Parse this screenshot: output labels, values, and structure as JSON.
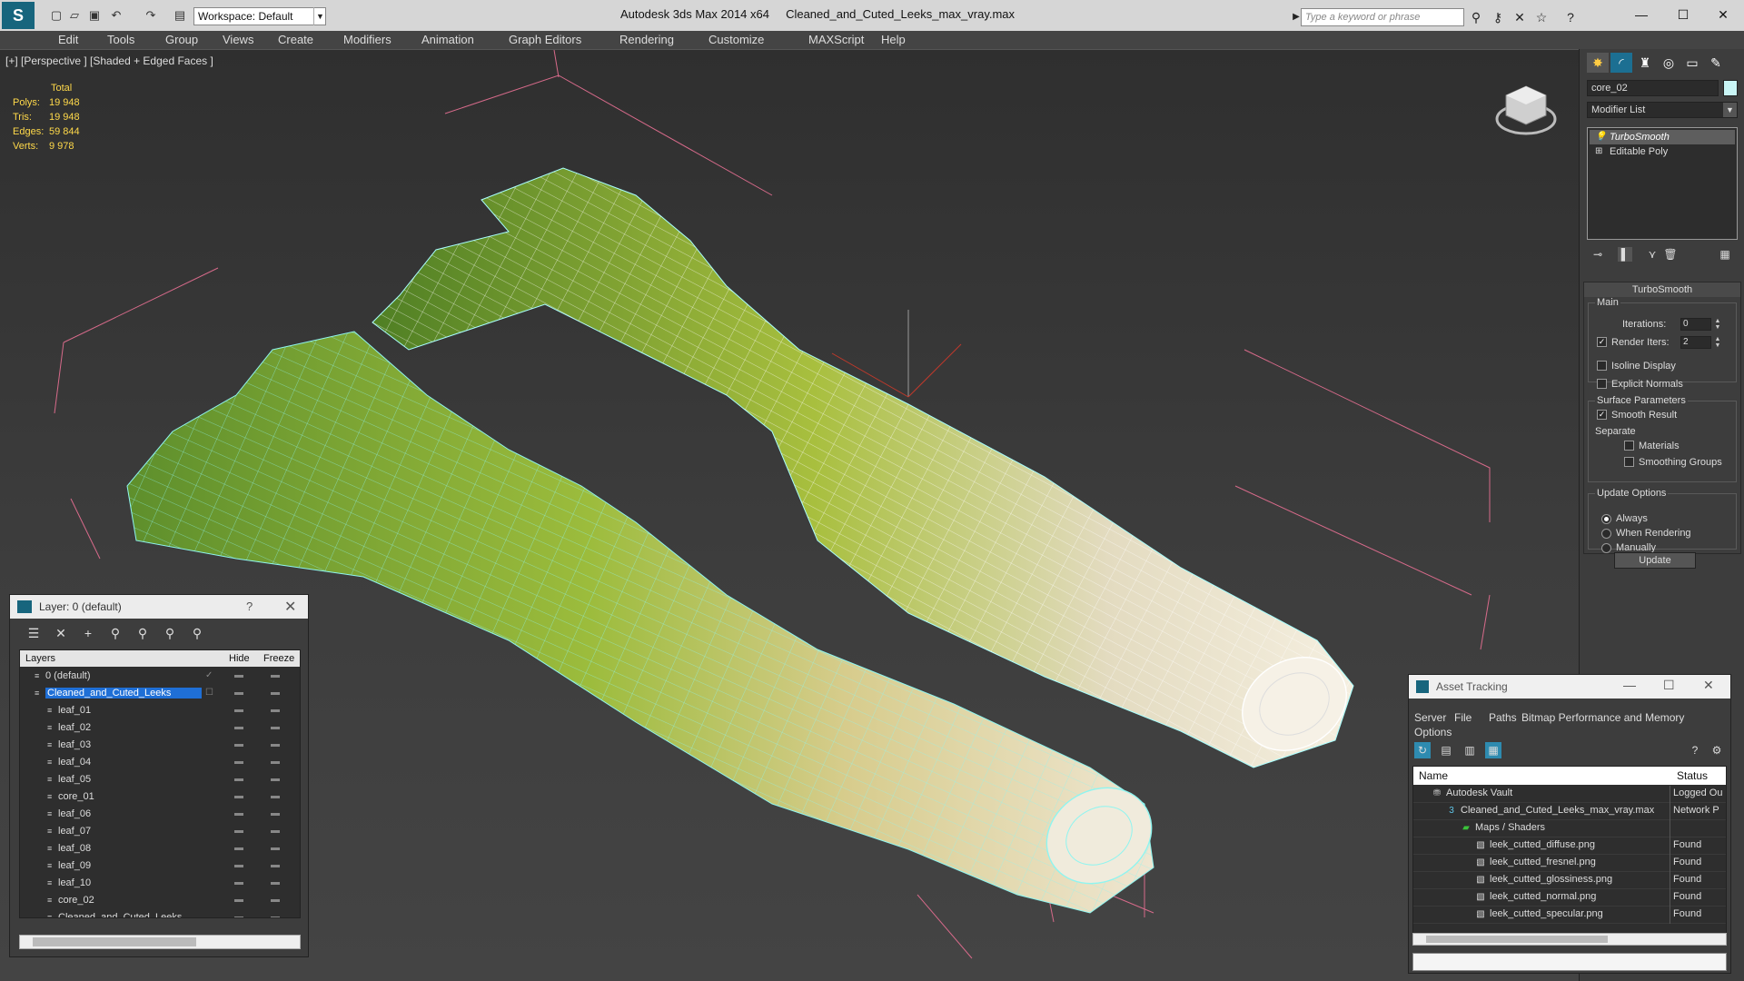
{
  "titlebar": {
    "workspace": "Workspace: Default",
    "app": "Autodesk 3ds Max  2014 x64",
    "file": "Cleaned_and_Cuted_Leeks_max_vray.max",
    "search_placeholder": "Type a keyword or phrase"
  },
  "menu": [
    "Edit",
    "Tools",
    "Group",
    "Views",
    "Create",
    "Modifiers",
    "Animation",
    "Graph Editors",
    "Rendering",
    "Customize",
    "MAXScript",
    "Help"
  ],
  "viewport": {
    "label": "[+] [Perspective ] [Shaded + Edged Faces ]",
    "stats": {
      "total": "Total",
      "rows": [
        {
          "label": "Polys:",
          "value": "19 948"
        },
        {
          "label": "Tris:",
          "value": "19 948"
        },
        {
          "label": "Edges:",
          "value": "59 844"
        },
        {
          "label": "Verts:",
          "value": "9 978"
        }
      ]
    },
    "colors": {
      "leaf_green": "#6e9a2e",
      "core_pale": "#efe6cc",
      "wire": "#7ff0f0",
      "bbox": "#d66a8a"
    }
  },
  "command_panel": {
    "object_name": "core_02",
    "modifier_list": "Modifier List",
    "stack": [
      "TurboSmooth",
      "Editable Poly"
    ],
    "rollout_title": "TurboSmooth",
    "main_label": "Main",
    "iterations_label": "Iterations:",
    "iterations_value": "0",
    "render_iters_label": "Render Iters:",
    "render_iters_value": "2",
    "isoline": "Isoline Display",
    "explicit": "Explicit Normals",
    "surface_params": "Surface Parameters",
    "smooth_result": "Smooth Result",
    "separate": "Separate",
    "materials": "Materials",
    "smoothing_groups": "Smoothing Groups",
    "update_options": "Update Options",
    "always": "Always",
    "when_rendering": "When Rendering",
    "manually": "Manually",
    "update_button": "Update"
  },
  "layer_dialog": {
    "title": "Layer: 0 (default)",
    "help": "?",
    "columns": {
      "layers": "Layers",
      "hide": "Hide",
      "freeze": "Freeze"
    },
    "rows": [
      {
        "name": "0 (default)",
        "level": 1,
        "checked": true,
        "selected": false
      },
      {
        "name": "Cleaned_and_Cuted_Leeks",
        "level": 1,
        "checked": false,
        "selected": true
      },
      {
        "name": "leaf_01",
        "level": 2,
        "checked": false,
        "selected": false
      },
      {
        "name": "leaf_02",
        "level": 2,
        "checked": false,
        "selected": false
      },
      {
        "name": "leaf_03",
        "level": 2,
        "checked": false,
        "selected": false
      },
      {
        "name": "leaf_04",
        "level": 2,
        "checked": false,
        "selected": false
      },
      {
        "name": "leaf_05",
        "level": 2,
        "checked": false,
        "selected": false
      },
      {
        "name": "core_01",
        "level": 2,
        "checked": false,
        "selected": false
      },
      {
        "name": "leaf_06",
        "level": 2,
        "checked": false,
        "selected": false
      },
      {
        "name": "leaf_07",
        "level": 2,
        "checked": false,
        "selected": false
      },
      {
        "name": "leaf_08",
        "level": 2,
        "checked": false,
        "selected": false
      },
      {
        "name": "leaf_09",
        "level": 2,
        "checked": false,
        "selected": false
      },
      {
        "name": "leaf_10",
        "level": 2,
        "checked": false,
        "selected": false
      },
      {
        "name": "core_02",
        "level": 2,
        "checked": false,
        "selected": false
      },
      {
        "name": "Cleaned_and_Cuted_Leeks",
        "level": 2,
        "checked": false,
        "selected": false
      }
    ]
  },
  "asset_tracking": {
    "title": "Asset Tracking",
    "menu": [
      "Server",
      "File",
      "Paths",
      "Bitmap Performance and Memory",
      "Options"
    ],
    "columns": {
      "name": "Name",
      "status": "Status"
    },
    "rows": [
      {
        "name": "Autodesk Vault",
        "status": "Logged Ou",
        "level": 1,
        "icon": "vault-icon"
      },
      {
        "name": "Cleaned_and_Cuted_Leeks_max_vray.max",
        "status": "Network P",
        "level": 2,
        "icon": "max-file-icon"
      },
      {
        "name": "Maps / Shaders",
        "status": "",
        "level": 3,
        "icon": "maps-icon"
      },
      {
        "name": "leek_cutted_diffuse.png",
        "status": "Found",
        "level": 4,
        "icon": "bitmap-icon"
      },
      {
        "name": "leek_cutted_fresnel.png",
        "status": "Found",
        "level": 4,
        "icon": "bitmap-icon"
      },
      {
        "name": "leek_cutted_glossiness.png",
        "status": "Found",
        "level": 4,
        "icon": "bitmap-icon"
      },
      {
        "name": "leek_cutted_normal.png",
        "status": "Found",
        "level": 4,
        "icon": "bitmap-icon"
      },
      {
        "name": "leek_cutted_specular.png",
        "status": "Found",
        "level": 4,
        "icon": "bitmap-icon"
      }
    ]
  }
}
